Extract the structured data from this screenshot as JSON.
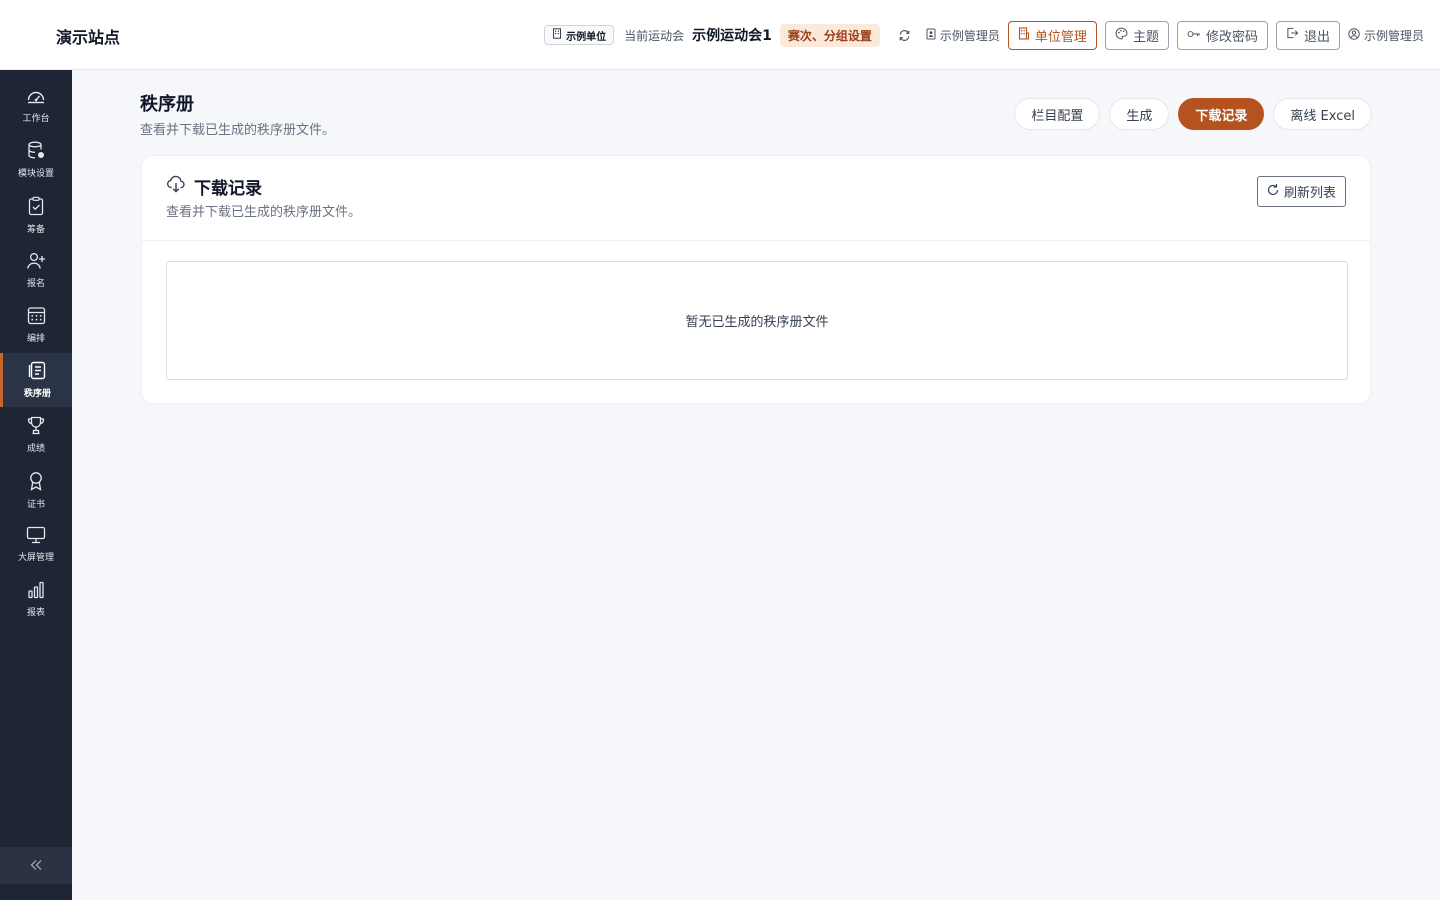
{
  "header": {
    "site_name": "演示站点",
    "unit_chip": "示例单位",
    "current_meet_label": "当前运动会",
    "current_meet": "示例运动会1",
    "stage_badge": "赛次、分组设置",
    "admin_label": "示例管理员",
    "buttons": {
      "unit_manage": "单位管理",
      "theme": "主题",
      "change_password": "修改密码",
      "logout": "退出"
    },
    "user_name": "示例管理员",
    "accent_color": "#b4531f"
  },
  "sidebar": {
    "items": [
      {
        "label": "工作台",
        "icon": "dashboard-gauge-icon"
      },
      {
        "label": "模块设置",
        "icon": "database-settings-icon"
      },
      {
        "label": "筹备",
        "icon": "clipboard-check-icon"
      },
      {
        "label": "报名",
        "icon": "user-plus-icon"
      },
      {
        "label": "编排",
        "icon": "calendar-grid-icon"
      },
      {
        "label": "秩序册",
        "icon": "document-list-icon",
        "active": true
      },
      {
        "label": "成绩",
        "icon": "trophy-icon"
      },
      {
        "label": "证书",
        "icon": "award-icon"
      },
      {
        "label": "大屏管理",
        "icon": "monitor-icon"
      },
      {
        "label": "报表",
        "icon": "bar-chart-icon"
      }
    ],
    "collapse_icon": "double-chevron-left-icon"
  },
  "page": {
    "title": "秩序册",
    "description": "查看并下载已生成的秩序册文件。",
    "tabs": [
      {
        "label": "栏目配置"
      },
      {
        "label": "生成"
      },
      {
        "label": "下载记录",
        "active": true
      },
      {
        "label": "离线 Excel"
      }
    ]
  },
  "card": {
    "title": "下载记录",
    "description": "查看并下载已生成的秩序册文件。",
    "refresh_label": "刷新列表",
    "empty_text": "暂无已生成的秩序册文件"
  }
}
